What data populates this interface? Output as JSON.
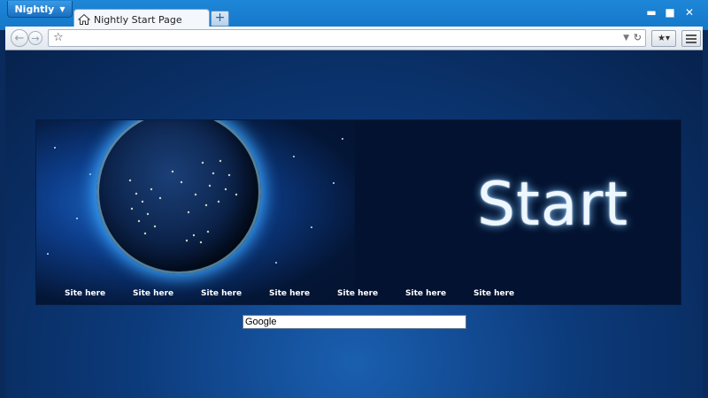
{
  "app_button": {
    "label": "Nightly"
  },
  "tab": {
    "title": "Nightly Start Page"
  },
  "newtab": {
    "label": "+"
  },
  "window": {
    "minimize": "▬",
    "maximize": "■",
    "close": "✕"
  },
  "navbar": {
    "url": ""
  },
  "banner": {
    "heading": "Start",
    "links": [
      "Site here",
      "Site here",
      "Site here",
      "Site here",
      "Site here",
      "Site here",
      "Site here"
    ]
  },
  "search": {
    "value": "Google"
  }
}
